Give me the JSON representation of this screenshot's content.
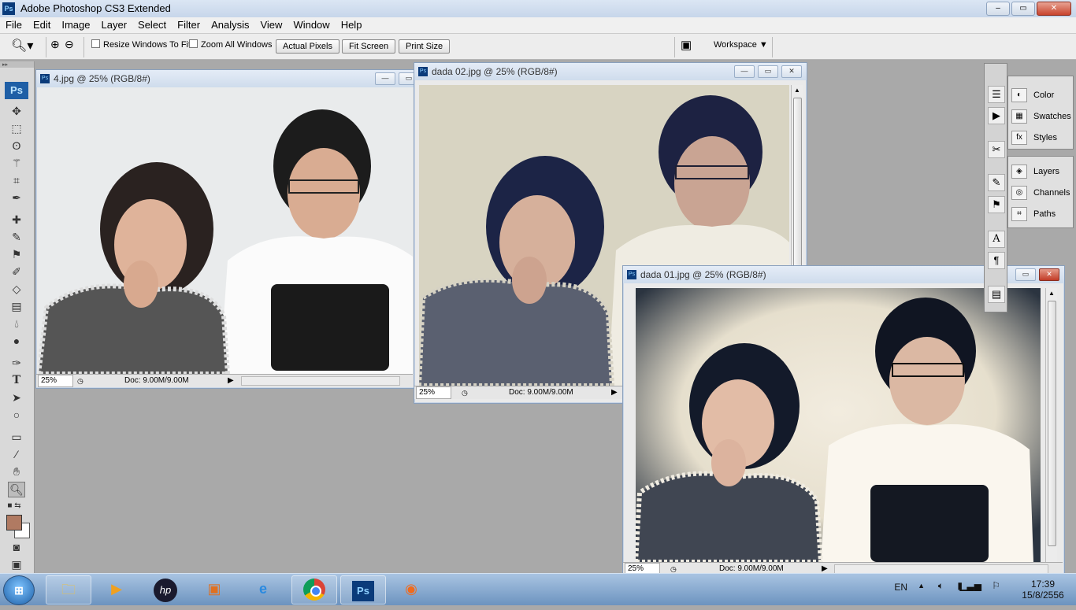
{
  "app": {
    "title": "Adobe Photoshop CS3 Extended",
    "logo": "Ps",
    "minimize": "–",
    "maximize": "▭",
    "close": "✕"
  },
  "menu": [
    "File",
    "Edit",
    "Image",
    "Layer",
    "Select",
    "Filter",
    "Analysis",
    "View",
    "Window",
    "Help"
  ],
  "options": {
    "resize_windows": "Resize Windows To Fit",
    "zoom_all": "Zoom All Windows",
    "actual_pixels": "Actual Pixels",
    "fit_screen": "Fit Screen",
    "print_size": "Print Size",
    "workspace": "Workspace ▼"
  },
  "toolbox": {
    "logo": "Ps"
  },
  "documents": [
    {
      "title": "4.jpg @ 25% (RGB/8#)",
      "zoom": "25%",
      "doc": "Doc: 9.00M/9.00M"
    },
    {
      "title": "dada 02.jpg @ 25% (RGB/8#)",
      "zoom": "25%",
      "doc": "Doc: 9.00M/9.00M"
    },
    {
      "title": "dada 01.jpg @ 25% (RGB/8#)",
      "zoom": "25%",
      "doc": "Doc: 9.00M/9.00M"
    }
  ],
  "panels": {
    "group1": [
      "Color",
      "Swatches",
      "Styles"
    ],
    "group2": [
      "Layers",
      "Channels",
      "Paths"
    ]
  },
  "taskbar": {
    "start": "⊞",
    "apps": [
      "file-explorer",
      "media-player",
      "hp",
      "network-tool",
      "internet-explorer",
      "chrome",
      "photoshop",
      "origin"
    ],
    "lang": "EN",
    "time": "17:39",
    "date": "15/8/2556"
  },
  "colors": {
    "foreground": "#b07a62",
    "background": "#ffffff"
  }
}
